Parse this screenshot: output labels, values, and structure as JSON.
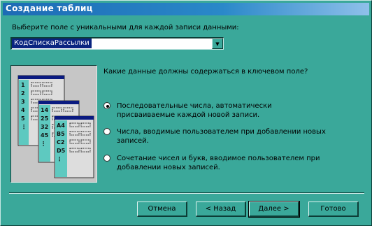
{
  "window": {
    "title": "Создание таблиц"
  },
  "field_prompt": "Выберите поле с уникальными для каждой записи данными:",
  "combo": {
    "value": "КодСпискаРассылки"
  },
  "question": "Какие данные должны содержаться в ключевом поле?",
  "options": [
    {
      "label": "Последовательные числа, автоматически присваиваемые каждой новой записи.",
      "selected": true
    },
    {
      "label": "Числа, вводимые пользователем при добавлении новых записей.",
      "selected": false
    },
    {
      "label": "Сочетание чисел и букв, вводимое пользователем при добавлении новых записей.",
      "selected": false
    }
  ],
  "illustration": {
    "card1": [
      "1",
      "2",
      "3",
      "4",
      "5",
      "⋮"
    ],
    "card2": [
      "14",
      "25",
      "32",
      "45",
      "⋮"
    ],
    "card3": [
      "A4",
      "B5",
      "C2",
      "D5",
      "⋮"
    ],
    "colors": {
      "card": "#dddddd",
      "header": "#0a1a80",
      "cell": "#5ec9c0"
    }
  },
  "buttons": {
    "cancel": "Отмена",
    "back": "< Назад",
    "next": "Далее >",
    "finish": "Готово"
  }
}
